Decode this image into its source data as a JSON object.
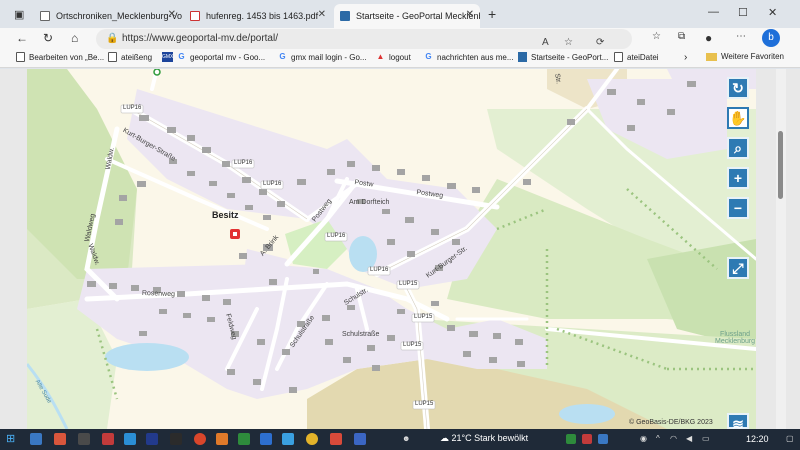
{
  "browser": {
    "tabs": [
      {
        "title": "Ortschroniken_Mecklenburg-Vo",
        "active": false
      },
      {
        "title": "hufenreg. 1453 bis 1463.pdf",
        "active": false
      },
      {
        "title": "Startseite - GeoPortal Mecklenburg",
        "active": true
      }
    ],
    "new_tab_symbol": "+",
    "url": "https://www.geoportal-mv.de/portal/",
    "bookmarks": [
      {
        "label": "Bearbeiten von „Be..."
      },
      {
        "label": "ateißeng"
      },
      {
        "label": "geoportal mv - Goo..."
      },
      {
        "label": "gmx mail login - Go..."
      },
      {
        "label": "logout"
      },
      {
        "label": "nachrichten aus me..."
      },
      {
        "label": "Startseite - GeoPort..."
      },
      {
        "label": "ateiDatei"
      },
      {
        "label": "Weitere Favoriten"
      }
    ],
    "gmx_badge": "GMX"
  },
  "map": {
    "town": "Besitz",
    "streets": {
      "kurt_burger_1": "Kurt-Burger-Straße",
      "kurt_burger_2": "Kurt-Burger-Str.",
      "postweg_1": "Postw",
      "postweg_2": "Postweg",
      "postweg_3": "Postweg",
      "am_dorfteich": "Am Dorfteich",
      "waldweg_1": "Waldweg",
      "waldweg_2": "Waldw.",
      "waldweg_3": "Waldw.",
      "rosenweg": "Rosenweg",
      "a_brink": "A. Brink",
      "feldweg": "Feldweg",
      "schulstr_1": "Schulstraße",
      "schulstr_2": "Schulstr.",
      "schulstr_3": "Schulstraße",
      "alte_sude": "Alte Sude",
      "top_str": "Str."
    },
    "route_labels": [
      "LUP16",
      "LUP16",
      "LUP16",
      "LUP16",
      "LUP16",
      "LUP15",
      "LUP15",
      "LUP15",
      "LUP15"
    ],
    "region": "Flussland\nMecklenburg",
    "copyright": "© GeoBasis-DE/BKG 2023"
  },
  "taskbar": {
    "weather": "21°C  Stark bewölkt",
    "time": "12:20"
  }
}
